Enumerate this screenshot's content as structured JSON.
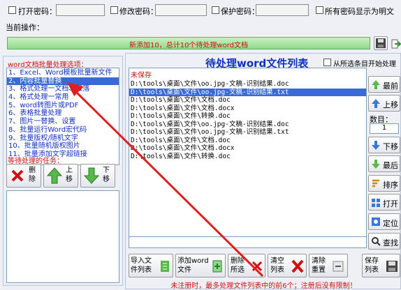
{
  "top": {
    "open_pw": "打开密码：",
    "modify_pw": "修改密码：",
    "protect_pw": "保护密码：",
    "show_plain": "所有密码显示为明文",
    "current_op": "当前操作："
  },
  "progress": {
    "text": "新添加10，总计10个待处理word文档",
    "fraction": 1.0
  },
  "left": {
    "options_title": "word文档批量处理选项：",
    "options": [
      "1、Excel、Word模板批量新文件",
      "2、内容批量替换",
      "3、格式处理一文档、段落",
      "4、格式处理一常用",
      "5、word转图片或PDF",
      "6、表格批量处理",
      "7、图片一替换、设置",
      "8、批量运行Word宏代码",
      "9、批量版权/随机文字",
      "10、批量随机版权图片",
      "11、批量添加文字超链接"
    ],
    "tasks_title": "等待处理的任务：",
    "delete_label": "删\n除",
    "up_label": "上\n移",
    "down_label": "下\n移"
  },
  "right": {
    "title": "待处理word文件列表",
    "from_selected": "从所选条目开始处理",
    "unsaved": "未保存",
    "files": [
      "D:\\tools\\桌面\\文件\\oo.jpg-文稿-识别结果.doc",
      "D:\\tools\\桌面\\文件\\oo.jpg-文稿-识别结果.txt",
      "D:\\tools\\桌面\\文件\\文档.doc",
      "D:\\tools\\桌面\\文件\\文档.docx",
      "D:\\tools\\桌面\\文件\\转换.doc",
      "D:\\tools\\桌面\\文件\\oo.jpg-文稿-识别结果.doc",
      "D:\\tools\\桌面\\文件\\oo.jpg-文稿-识别结果.txt",
      "D:\\tools\\桌面\\文件\\文档.doc",
      "D:\\tools\\桌面\\文件\\文档.docx",
      "D:\\tools\\桌面\\文件\\转换.doc"
    ],
    "side_buttons": {
      "top": "最前",
      "up": "上移",
      "count_label": "数目：",
      "count_value": "1",
      "down": "下移",
      "last": "最后",
      "sort": "排序",
      "open": "打开",
      "locate": "定位",
      "find": "查找"
    },
    "bottom_buttons": {
      "import": "导入文\n件列表",
      "add": "添加word\n文件",
      "delete": "删除\n所选",
      "clear": "清空\n列表",
      "reset": "清除\n重置",
      "save": "保存\n列表"
    },
    "footer": "未注册时，最多处理文件列表中的前6个；注册后没有限制！"
  },
  "colors": {
    "accent_green": "#2c9a2c",
    "red": "#d01010",
    "select": "#3a6ad6"
  }
}
